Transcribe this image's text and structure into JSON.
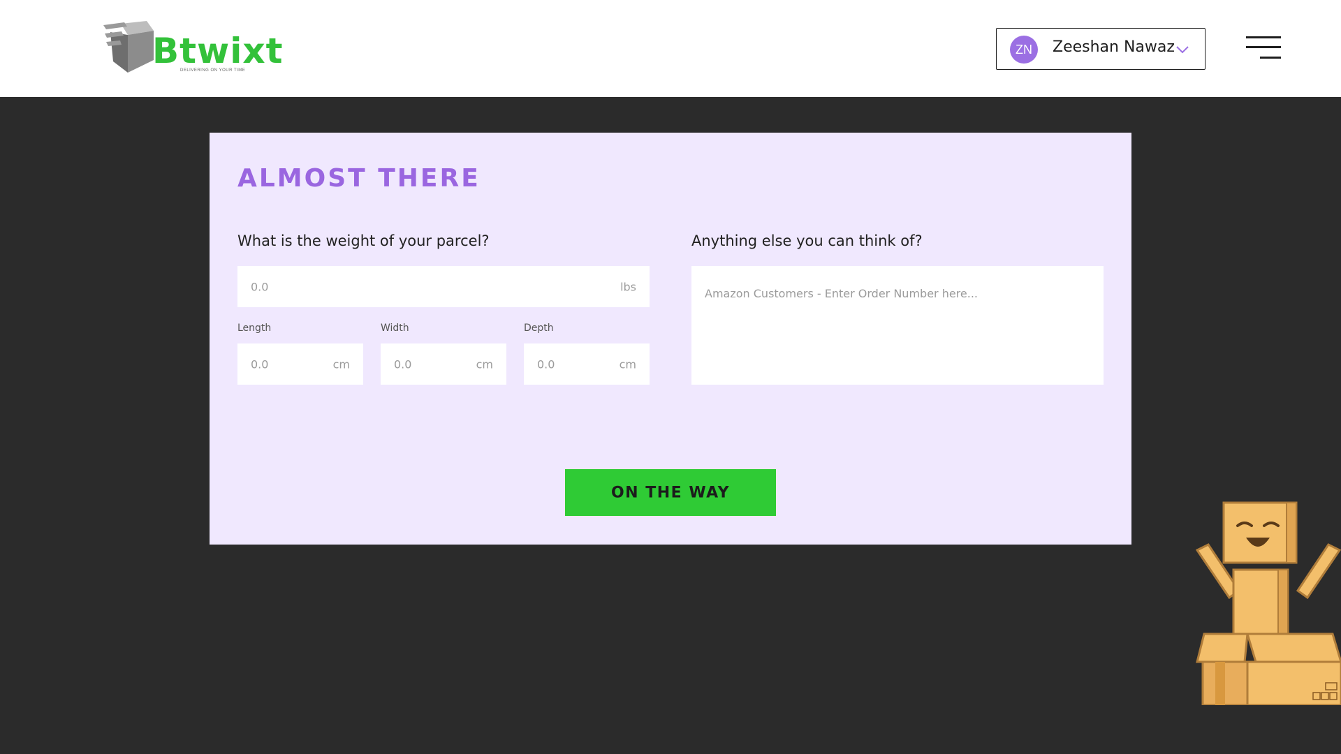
{
  "header": {
    "logo_text": "Btwixt",
    "logo_tagline": "DELIVERING ON YOUR TIME",
    "user": {
      "initials": "ZN",
      "name": "Zeeshan Nawaz"
    }
  },
  "form": {
    "title": "Almost there",
    "weight": {
      "label": "What is the weight of your parcel?",
      "placeholder": "0.0",
      "unit": "lbs"
    },
    "dimensions": [
      {
        "label": "Length",
        "placeholder": "0.0",
        "unit": "cm"
      },
      {
        "label": "Width",
        "placeholder": "0.0",
        "unit": "cm"
      },
      {
        "label": "Depth",
        "placeholder": "0.0",
        "unit": "cm"
      }
    ],
    "notes": {
      "label": "Anything else you can think of?",
      "placeholder": "Amazon Customers - Enter Order Number here..."
    },
    "submit_label": "On the way"
  },
  "colors": {
    "accent_purple": "#9a66e0",
    "brand_green": "#2fcb35",
    "card_bg": "#f0e8fe",
    "page_bg": "#2b2b2b"
  },
  "icons": {
    "user_dropdown": "chevron-down-icon",
    "menu": "hamburger-menu-icon",
    "mascot": "box-robot-mascot"
  }
}
